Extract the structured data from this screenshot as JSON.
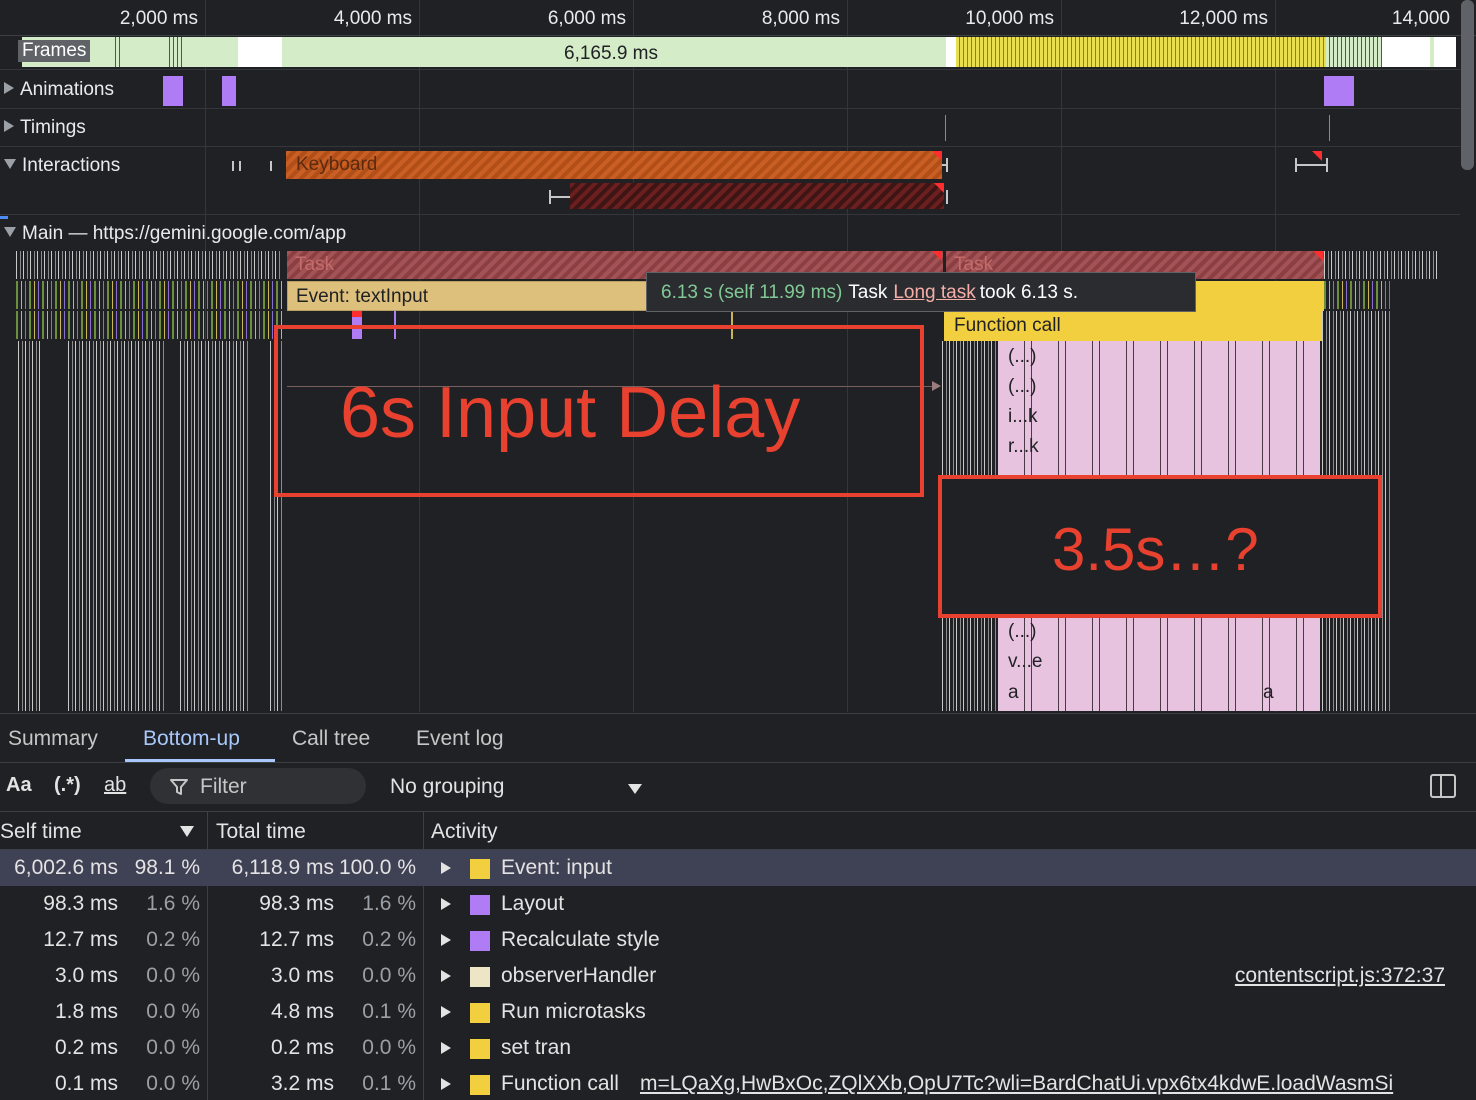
{
  "ruler": {
    "ticks": [
      "2,000 ms",
      "4,000 ms",
      "6,000 ms",
      "8,000 ms",
      "10,000 ms",
      "12,000 ms",
      "14,000"
    ]
  },
  "tracks": {
    "frames_label": "Frames",
    "frames_value": "6,165.9 ms",
    "animations_label": "Animations",
    "timings_label": "Timings",
    "interactions_label": "Interactions",
    "keyboard_label": "Keyboard",
    "main_label": "Main — https://gemini.google.com/app"
  },
  "flame": {
    "task_label": "Task",
    "task2_label": "Task",
    "event_label": "Event: textInput",
    "function_call_label": "Function call",
    "cells": [
      "(...)",
      "(...)",
      "i...k",
      "r...k",
      "(...)",
      "v...e",
      "a",
      "a"
    ]
  },
  "tooltip": {
    "time": "6.13 s (self 11.99 ms)",
    "task": "Task",
    "link": "Long task",
    "rest": "took 6.13 s."
  },
  "annotations": {
    "input_delay": "6s Input Delay",
    "mystery": "3.5s…?",
    "color": "#e8412f"
  },
  "panel": {
    "tabs": [
      "Summary",
      "Bottom-up",
      "Call tree",
      "Event log"
    ],
    "active_tab": "Bottom-up",
    "toolbar": {
      "match_case": "Aa",
      "regex": "(.*)",
      "whole_word": "ab",
      "filter_placeholder": "Filter",
      "grouping": "No grouping"
    },
    "columns": {
      "self": "Self time",
      "total": "Total time",
      "activity": "Activity"
    },
    "rows": [
      {
        "self": "6,002.6 ms",
        "self_pct": "98.1 %",
        "total": "6,118.9 ms",
        "total_pct": "100.0 %",
        "activity": "Event: input",
        "color": "#f2cf3e",
        "source": ""
      },
      {
        "self": "98.3 ms",
        "self_pct": "1.6 %",
        "total": "98.3 ms",
        "total_pct": "1.6 %",
        "activity": "Layout",
        "color": "#b07cf6",
        "source": ""
      },
      {
        "self": "12.7 ms",
        "self_pct": "0.2 %",
        "total": "12.7 ms",
        "total_pct": "0.2 %",
        "activity": "Recalculate style",
        "color": "#b07cf6",
        "source": ""
      },
      {
        "self": "3.0 ms",
        "self_pct": "0.0 %",
        "total": "3.0 ms",
        "total_pct": "0.0 %",
        "activity": "observerHandler",
        "color": "#ede6c6",
        "source": "contentscript.js:372:37"
      },
      {
        "self": "1.8 ms",
        "self_pct": "0.0 %",
        "total": "4.8 ms",
        "total_pct": "0.1 %",
        "activity": "Run microtasks",
        "color": "#f2cf3e",
        "source": ""
      },
      {
        "self": "0.2 ms",
        "self_pct": "0.0 %",
        "total": "0.2 ms",
        "total_pct": "0.0 %",
        "activity": "set tran",
        "color": "#f2cf3e",
        "source": ""
      },
      {
        "self": "0.1 ms",
        "self_pct": "0.0 %",
        "total": "3.2 ms",
        "total_pct": "0.1 %",
        "activity": "Function call",
        "color": "#f2cf3e",
        "source": "m=LQaXg,HwBxOc,ZQlXXb,OpU7Tc?wli=BardChatUi.vpx6tx4kdwE.loadWasmSi"
      }
    ]
  }
}
